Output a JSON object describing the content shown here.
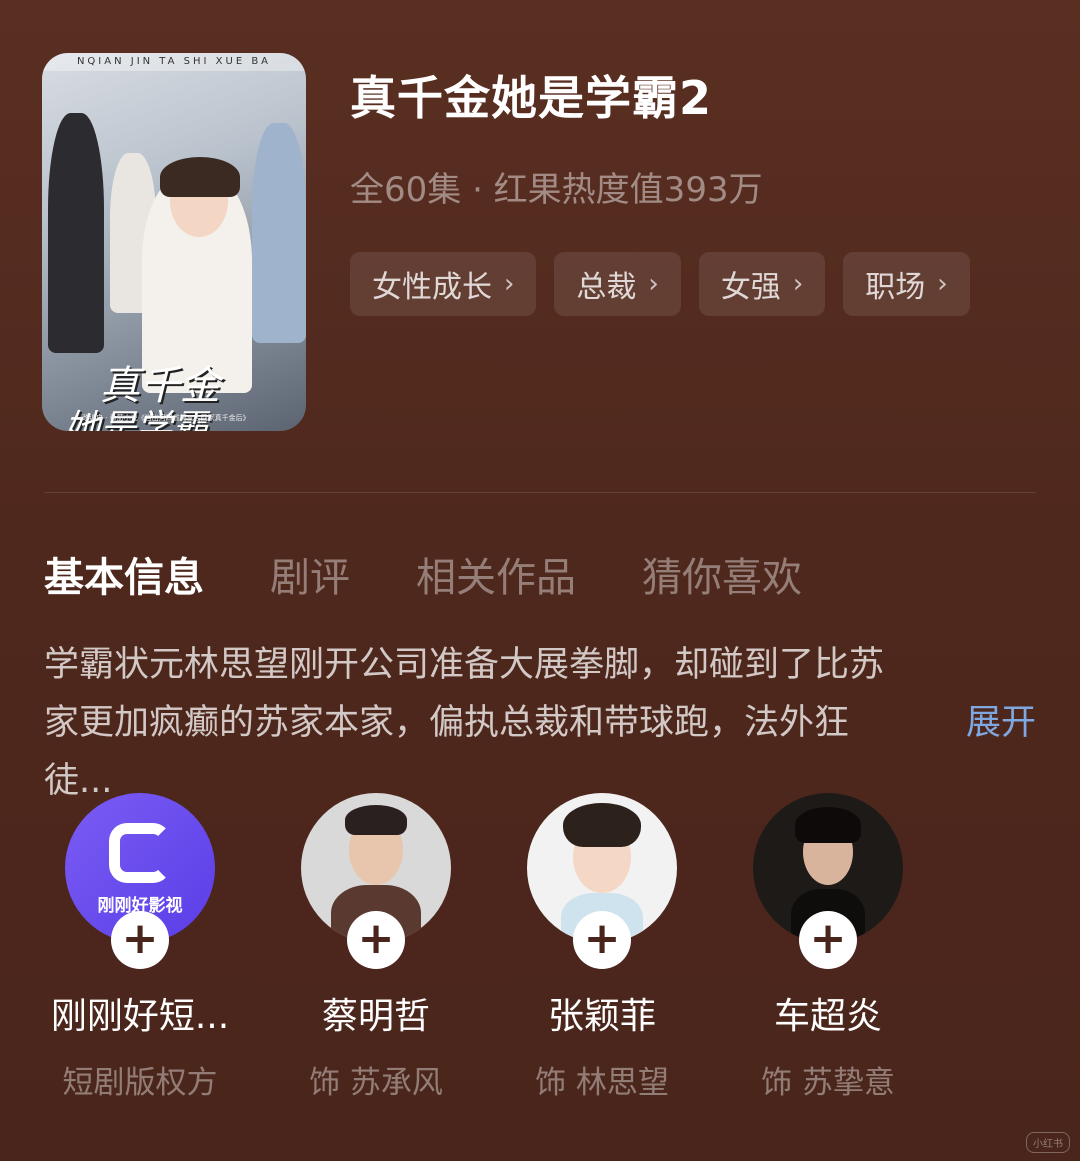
{
  "drama": {
    "title": "真千金她是学霸2",
    "meta": "全60集 · 红果热度值393万",
    "poster": {
      "band_text": "NQIAN JIN TA SHI XUE BA",
      "title_line1": "真千金",
      "title_line2": "她是学霸",
      "fine_print": "改编自 · 番茄小说《当山河四省第三名回家真千金后》"
    },
    "tags": [
      "女性成长",
      "总裁",
      "女强",
      "职场"
    ]
  },
  "tabs": [
    "基本信息",
    "剧评",
    "相关作品",
    "猜你喜欢"
  ],
  "description": {
    "text": "学霸状元林思望刚开公司准备大展拳脚，却碰到了比苏家更加疯癫的苏家本家，偏执总裁和带球跑，法外狂徒...",
    "expand_label": "展开"
  },
  "cast": [
    {
      "name": "刚刚好短...",
      "role": "短剧版权方",
      "logo_text": "刚刚好影视",
      "type": "studio"
    },
    {
      "name": "蔡明哲",
      "role": "饰 苏承风",
      "type": "actor"
    },
    {
      "name": "张颖菲",
      "role": "饰 林思望",
      "type": "actor"
    },
    {
      "name": "车超炎",
      "role": "饰 苏挚意",
      "type": "actor"
    }
  ],
  "watermark": "小红书",
  "colors": {
    "background": "#4f281d",
    "expand_link": "#7fa7e0",
    "studio_logo_bg": "#6a4cf0"
  }
}
